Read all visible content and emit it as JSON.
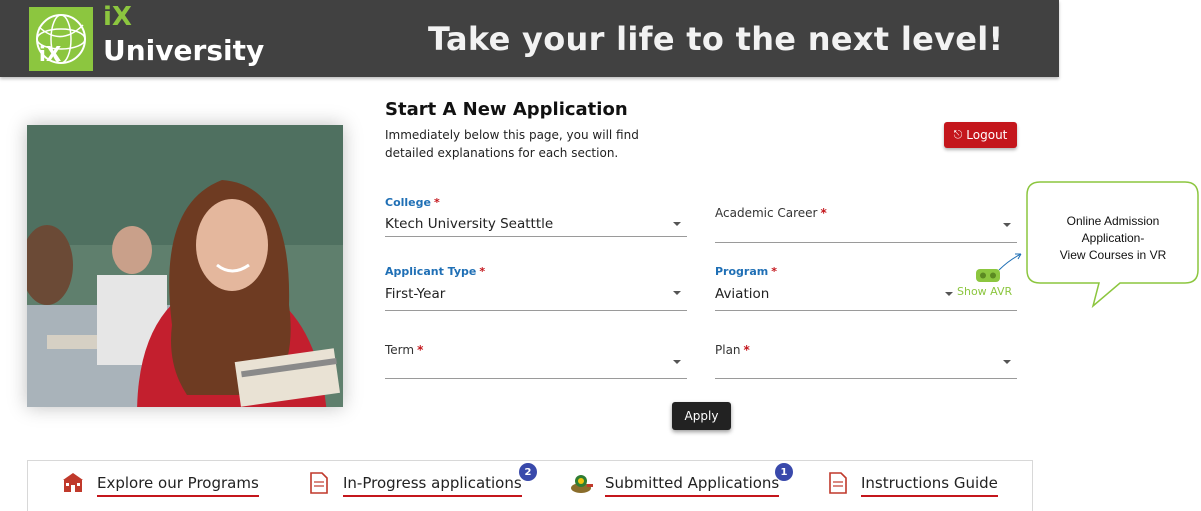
{
  "brand": {
    "logo_text": "iX",
    "short": "iX",
    "name": "University"
  },
  "header": {
    "tagline": "Take your life to the next level!"
  },
  "form": {
    "title": "Start A New Application",
    "subtitle": "Immediately below this page, you will find detailed explanations for each section.",
    "logout_label": "Logout",
    "fields": {
      "college": {
        "label": "College",
        "value": "Ktech University Seatttle",
        "required_mark": "*"
      },
      "academic_career": {
        "label": "Academic Career",
        "value": "",
        "required_mark": "*"
      },
      "applicant_type": {
        "label": "Applicant Type",
        "value": "First-Year",
        "required_mark": "*"
      },
      "program": {
        "label": "Program",
        "value": "Aviation",
        "required_mark": "*"
      },
      "term": {
        "label": "Term",
        "value": "",
        "required_mark": "*"
      },
      "plan": {
        "label": "Plan",
        "value": "",
        "required_mark": "*"
      }
    },
    "show_avr_label": "Show AVR",
    "apply_label": "Apply"
  },
  "callout": {
    "line1": "Online Admission",
    "line2": "Application-",
    "line3": "View Courses in VR"
  },
  "nav": [
    {
      "label": "Explore our Programs",
      "icon": "school-building-icon"
    },
    {
      "label": "In-Progress applications",
      "icon": "document-icon",
      "badge": "2"
    },
    {
      "label": "Submitted Applications",
      "icon": "submit-stamp-icon",
      "badge": "1"
    },
    {
      "label": "Instructions Guide",
      "icon": "guide-document-icon"
    }
  ],
  "colors": {
    "brand_green": "#8cc63f",
    "header_bg": "#414141",
    "accent_red": "#c4161c",
    "label_blue": "#1f6fb5",
    "badge_blue": "#3949ab"
  }
}
